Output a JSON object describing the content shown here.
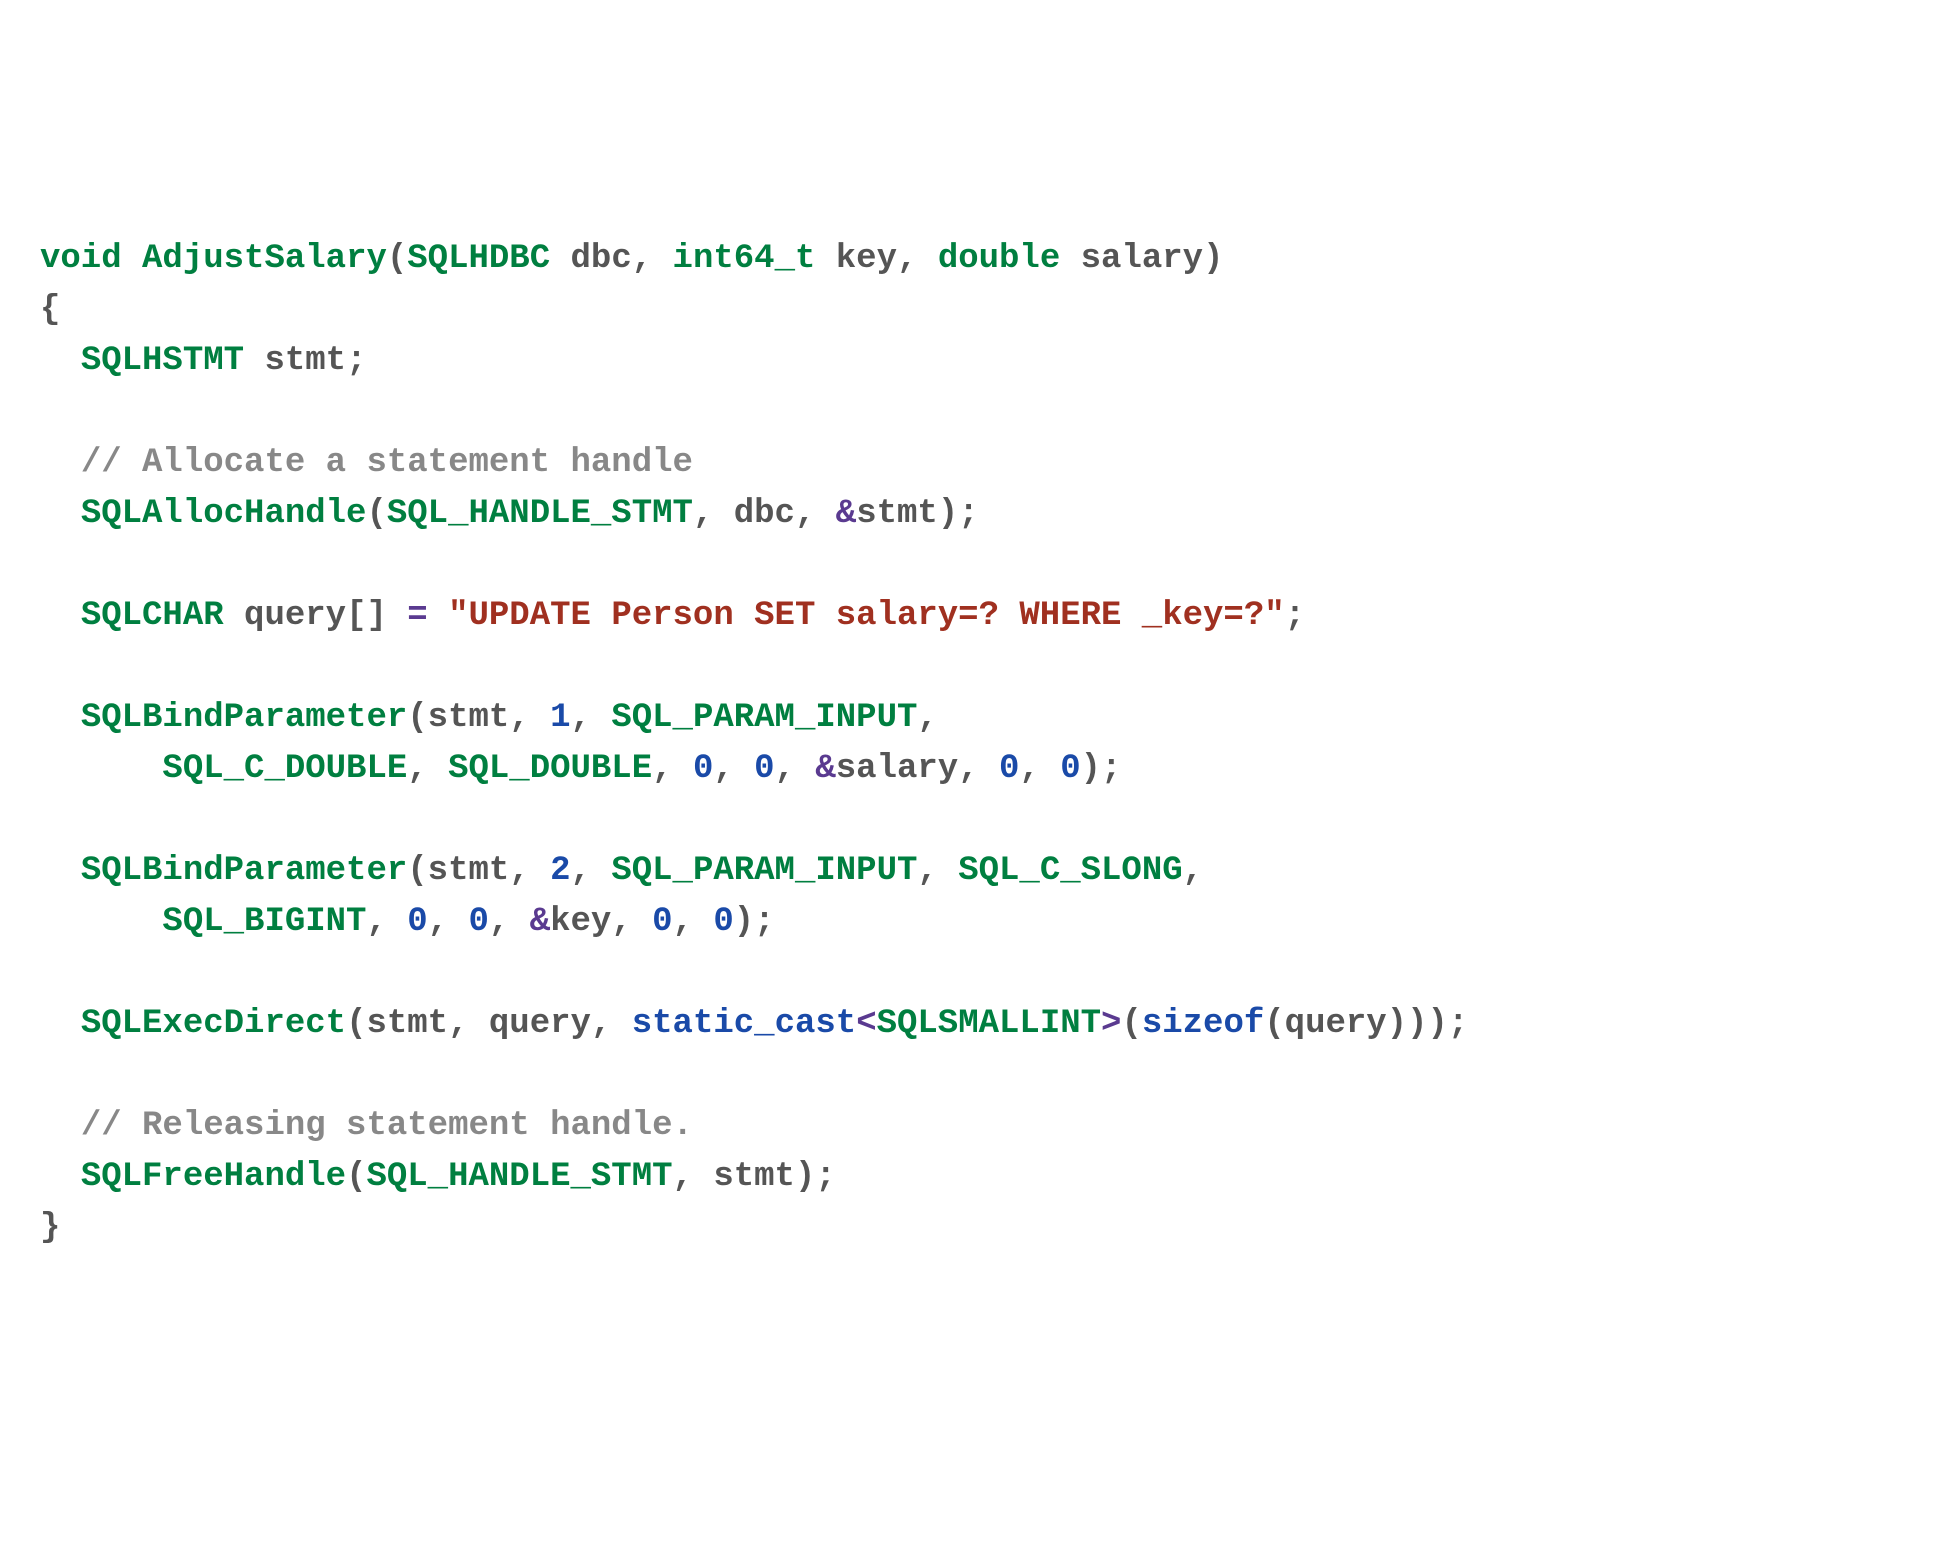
{
  "code": {
    "l1": {
      "void": "void",
      "fn": "AdjustSalary",
      "p_open": "(",
      "t1": "SQLHDBC",
      "a1": " dbc",
      "c1": ", ",
      "t2": "int64_t",
      "a2": " key",
      "c2": ", ",
      "t3": "double",
      "a3": " salary",
      "p_close": ")"
    },
    "l2": {
      "b": "{"
    },
    "l3": {
      "indent": "  ",
      "t": "SQLHSTMT",
      "id": " stmt",
      "s": ";"
    },
    "l4": {
      "indent": "  ",
      "cmt": "// Allocate a statement handle"
    },
    "l5": {
      "indent": "  ",
      "fn": "SQLAllocHandle",
      "p": "(",
      "a1": "SQL_HANDLE_STMT",
      "c1": ", ",
      "a2": "dbc",
      "c2": ", ",
      "amp": "&",
      "a3": "stmt",
      "cl": ");"
    },
    "l6": {
      "indent": "  ",
      "t": "SQLCHAR",
      "id": " query",
      "br": "[] ",
      "eq": "=",
      "sp": " ",
      "str": "\"UPDATE Person SET salary=? WHERE _key=?\"",
      "s": ";"
    },
    "l7a": {
      "indent": "  ",
      "fn": "SQLBindParameter",
      "p": "(",
      "a1": "stmt",
      "c1": ", ",
      "n1": "1",
      "c2": ", ",
      "a2": "SQL_PARAM_INPUT",
      "c3": ","
    },
    "l7b": {
      "indent": "      ",
      "a1": "SQL_C_DOUBLE",
      "c1": ", ",
      "a2": "SQL_DOUBLE",
      "c2": ", ",
      "n1": "0",
      "c3": ", ",
      "n2": "0",
      "c4": ", ",
      "amp": "&",
      "a3": "salary",
      "c5": ", ",
      "n3": "0",
      "c6": ", ",
      "n4": "0",
      "cl": ");"
    },
    "l8a": {
      "indent": "  ",
      "fn": "SQLBindParameter",
      "p": "(",
      "a1": "stmt",
      "c1": ", ",
      "n1": "2",
      "c2": ", ",
      "a2": "SQL_PARAM_INPUT",
      "c3": ", ",
      "a3": "SQL_C_SLONG",
      "c4": ","
    },
    "l8b": {
      "indent": "      ",
      "a1": "SQL_BIGINT",
      "c1": ", ",
      "n1": "0",
      "c2": ", ",
      "n2": "0",
      "c3": ", ",
      "amp": "&",
      "a2": "key",
      "c4": ", ",
      "n3": "0",
      "c5": ", ",
      "n4": "0",
      "cl": ");"
    },
    "l9": {
      "indent": "  ",
      "fn": "SQLExecDirect",
      "p": "(",
      "a1": "stmt",
      "c1": ", ",
      "a2": "query",
      "c2": ", ",
      "sc": "static_cast",
      "lt": "<",
      "t": "SQLSMALLINT",
      "gt": ">",
      "p2": "(",
      "so": "sizeof",
      "p3": "(",
      "a3": "query",
      "cl": ")));"
    },
    "l10": {
      "indent": "  ",
      "cmt": "// Releasing statement handle."
    },
    "l11": {
      "indent": "  ",
      "fn": "SQLFreeHandle",
      "p": "(",
      "a1": "SQL_HANDLE_STMT",
      "c1": ", ",
      "a2": "stmt",
      "cl": ");"
    },
    "l12": {
      "b": "}"
    }
  }
}
